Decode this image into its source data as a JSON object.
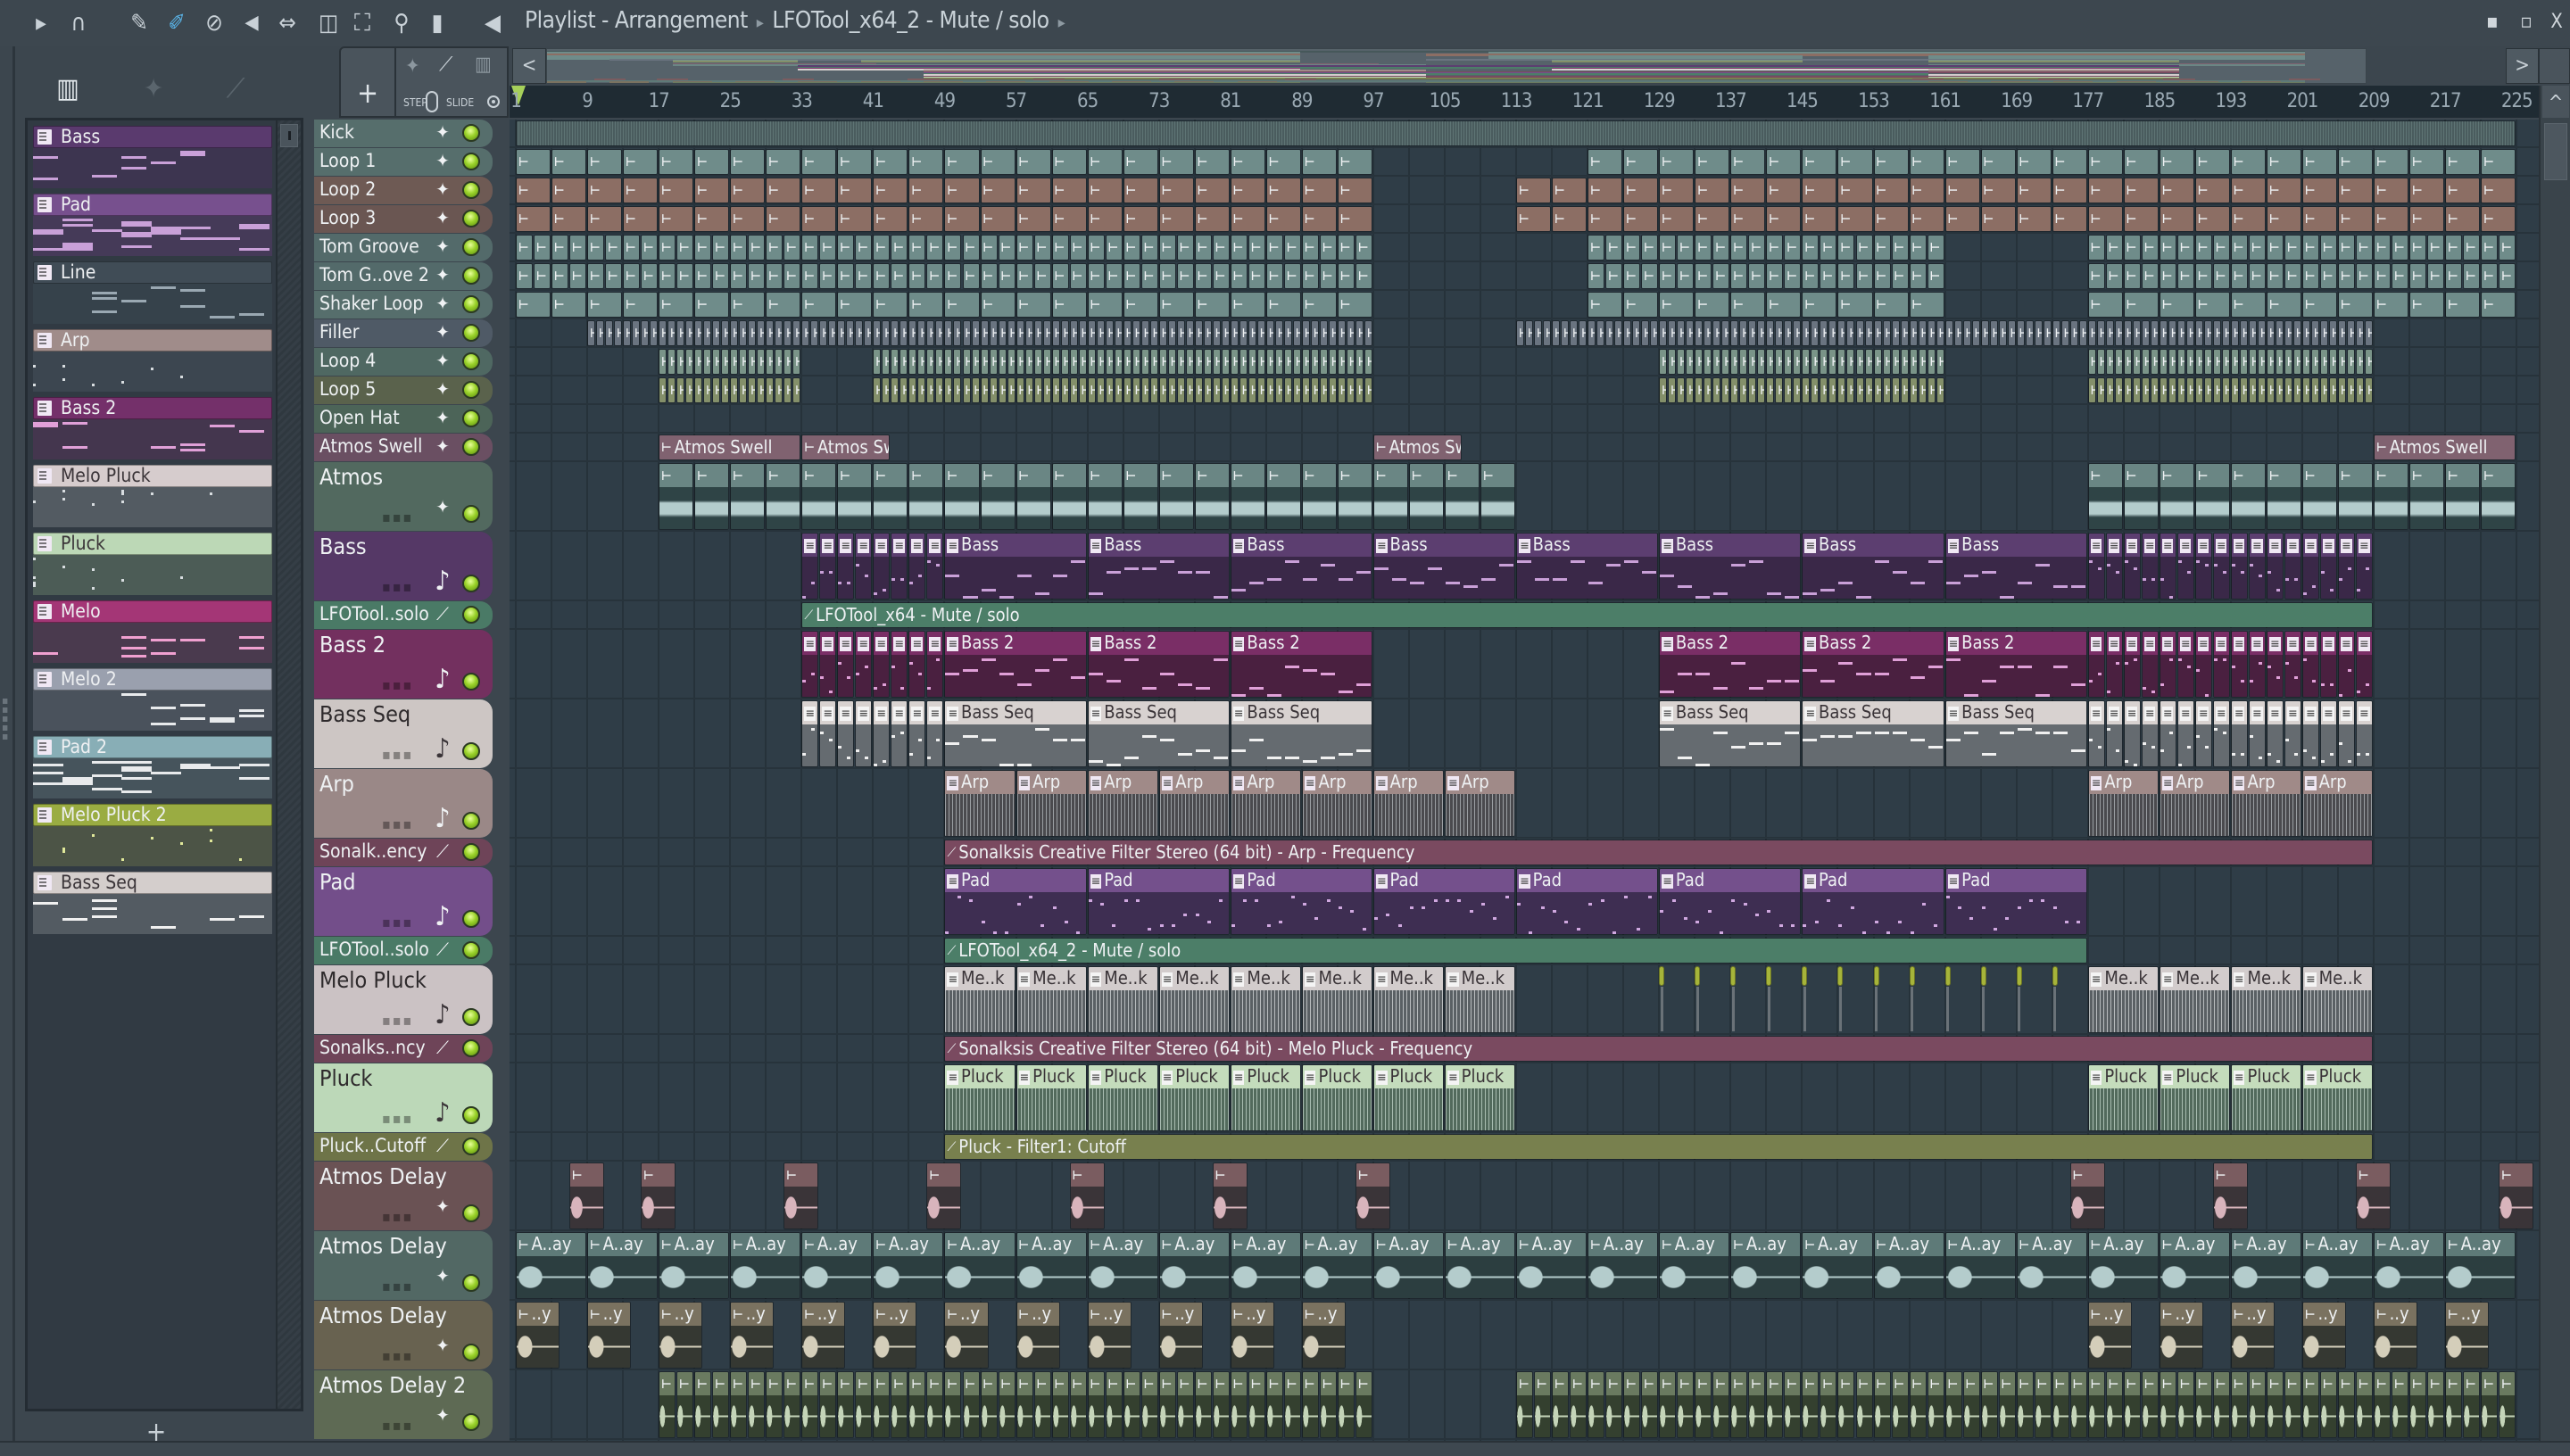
{
  "window": {
    "title": "Playlist - Arrangement",
    "breadcrumb": "LFOTool_x64_2 - Mute / solo",
    "controls": {
      "minimize": "▪",
      "maximize": "▫",
      "close": "X"
    }
  },
  "toolbar": {
    "icons": [
      "menu-arrow-icon",
      "magnet-snap-icon",
      "pencil-icon",
      "paint-brush-icon",
      "delete-icon",
      "mute-icon",
      "slip-icon",
      "select-icon",
      "zoom-select-icon",
      "zoom-icon",
      "playback-icon",
      "speaker-icon"
    ],
    "active_tool": "paint-brush-icon",
    "accent": "#5ab4e8"
  },
  "tools_panel": {
    "add_label": "+",
    "step_label": "STEP",
    "slide_label": "SLIDE"
  },
  "ruler": {
    "bars": [
      "1",
      "9",
      "17",
      "25",
      "33",
      "41",
      "49",
      "57",
      "65",
      "73",
      "81",
      "89",
      "97",
      "105",
      "113",
      "121",
      "129",
      "137",
      "145",
      "153",
      "161",
      "169",
      "177",
      "185",
      "193",
      "201",
      "209",
      "217",
      "225"
    ]
  },
  "scroll": {
    "up": "^",
    "left": "<",
    "right": ">"
  },
  "picker": {
    "add_label": "+",
    "channels": [
      {
        "name": "Bass",
        "color": "#5a3a6e",
        "note": "#c9a0d8",
        "bg": "#3d3550",
        "dark": false
      },
      {
        "name": "Pad",
        "color": "#77508e",
        "note": "#c9a0d8",
        "bg": "#453a58",
        "dark": false
      },
      {
        "name": "Line",
        "color": "#404c56",
        "note": "#9aa8b2",
        "bg": "#36424b",
        "dark": false
      },
      {
        "name": "Arp",
        "color": "#a08c8a",
        "note": "#d8dde0",
        "bg": "#3c4650",
        "dark": false
      },
      {
        "name": "Bass 2",
        "color": "#74306a",
        "note": "#e0a0d8",
        "bg": "#44364e",
        "dark": false
      },
      {
        "name": "Melo Pluck",
        "color": "#d6cccd",
        "note": "#d8dde0",
        "bg": "#535b62",
        "dark": true
      },
      {
        "name": "Pluck",
        "color": "#bcd8b6",
        "note": "#d8dde0",
        "bg": "#4c5c56",
        "dark": true
      },
      {
        "name": "Melo",
        "color": "#a43676",
        "note": "#f0a0d0",
        "bg": "#4a3a4e",
        "dark": false
      },
      {
        "name": "Melo 2",
        "color": "#9aa0ae",
        "note": "#e8eaec",
        "bg": "#4a525c",
        "dark": false
      },
      {
        "name": "Pad 2",
        "color": "#88aeb6",
        "note": "#e8eaec",
        "bg": "#46545c",
        "dark": false
      },
      {
        "name": "Melo Pluck 2",
        "color": "#9aac42",
        "note": "#e0e89a",
        "bg": "#4c5446",
        "dark": false
      },
      {
        "name": "Bass Seq",
        "color": "#d4cecc",
        "note": "#f0f0f0",
        "bg": "#535b62",
        "dark": true
      }
    ]
  },
  "tracks": [
    {
      "name": "Kick",
      "kind": "audio",
      "color": "#566e6c",
      "clip": "#46585a",
      "clips": [
        {
          "s": 1,
          "e": 225,
          "step": 224,
          "label": ""
        }
      ]
    },
    {
      "name": "Loop 1",
      "kind": "audio",
      "color": "#566e6c",
      "clip": "#6f8c8a",
      "clips": [
        {
          "s": 1,
          "e": 97,
          "step": 4,
          "label": ""
        },
        {
          "s": 121,
          "e": 225,
          "step": 4,
          "label": ""
        }
      ]
    },
    {
      "name": "Loop 2",
      "kind": "audio",
      "color": "#6e5a54",
      "clip": "#8c6e64",
      "clips": [
        {
          "s": 1,
          "e": 97,
          "step": 4,
          "label": ""
        },
        {
          "s": 113,
          "e": 225,
          "step": 4,
          "label": ""
        }
      ]
    },
    {
      "name": "Loop 3",
      "kind": "audio",
      "color": "#6a5652",
      "clip": "#8c6e64",
      "clips": [
        {
          "s": 1,
          "e": 97,
          "step": 4,
          "label": ""
        },
        {
          "s": 113,
          "e": 225,
          "step": 4,
          "label": ""
        }
      ]
    },
    {
      "name": "Tom Groove",
      "kind": "audio",
      "color": "#536a6a",
      "clip": "#6f8c8a",
      "clips": [
        {
          "s": 1,
          "e": 97,
          "step": 2,
          "label": ""
        },
        {
          "s": 121,
          "e": 161,
          "step": 2,
          "label": ""
        },
        {
          "s": 177,
          "e": 225,
          "step": 2,
          "label": ""
        }
      ]
    },
    {
      "name": "Tom G..ove 2",
      "kind": "audio",
      "color": "#536a6a",
      "clip": "#6f8c8a",
      "clips": [
        {
          "s": 1,
          "e": 97,
          "step": 2,
          "label": ""
        },
        {
          "s": 121,
          "e": 161,
          "step": 2,
          "label": ""
        },
        {
          "s": 177,
          "e": 225,
          "step": 2,
          "label": ""
        }
      ]
    },
    {
      "name": "Shaker Loop",
      "kind": "audio",
      "color": "#566e6c",
      "clip": "#6f8c8a",
      "clips": [
        {
          "s": 1,
          "e": 97,
          "step": 4,
          "label": ""
        },
        {
          "s": 121,
          "e": 161,
          "step": 4,
          "label": ""
        },
        {
          "s": 177,
          "e": 225,
          "step": 4,
          "label": ""
        }
      ]
    },
    {
      "name": "Filler",
      "kind": "audio",
      "color": "#4f5a66",
      "clip": "#6a7480",
      "clips": [
        {
          "s": 9,
          "e": 97,
          "step": 1,
          "label": ""
        },
        {
          "s": 113,
          "e": 209,
          "step": 1,
          "label": ""
        }
      ]
    },
    {
      "name": "Loop 4",
      "kind": "audio",
      "color": "#4f6862",
      "clip": "#7a9488",
      "clips": [
        {
          "s": 17,
          "e": 33,
          "step": 1,
          "label": ""
        },
        {
          "s": 41,
          "e": 97,
          "step": 1,
          "label": ""
        },
        {
          "s": 129,
          "e": 161,
          "step": 1,
          "label": ""
        },
        {
          "s": 177,
          "e": 209,
          "step": 1,
          "label": ""
        }
      ]
    },
    {
      "name": "Loop 5",
      "kind": "audio",
      "color": "#5a624c",
      "clip": "#84906a",
      "clips": [
        {
          "s": 17,
          "e": 33,
          "step": 1,
          "label": ""
        },
        {
          "s": 41,
          "e": 97,
          "step": 1,
          "label": ""
        },
        {
          "s": 129,
          "e": 161,
          "step": 1,
          "label": ""
        },
        {
          "s": 177,
          "e": 209,
          "step": 1,
          "label": ""
        }
      ]
    },
    {
      "name": "Open Hat",
      "kind": "audio",
      "color": "#4c6458",
      "clip": "#60786c",
      "clips": []
    },
    {
      "name": "Atmos Swell",
      "kind": "audio",
      "color": "#6a4f62",
      "clip": "#806270",
      "clips": [
        {
          "s": 17,
          "e": 33,
          "step": 16,
          "label": "Atmos Swell"
        },
        {
          "s": 33,
          "e": 43,
          "step": 10,
          "label": "Atmos Swell"
        },
        {
          "s": 97,
          "e": 107,
          "step": 10,
          "label": "Atmos Swell"
        },
        {
          "s": 209,
          "e": 225,
          "step": 16,
          "label": "Atmos Swell"
        }
      ]
    },
    {
      "name": "Atmos",
      "kind": "audio",
      "color": "#52695f",
      "clip": "#6a8684",
      "body": "#2f4446",
      "wave": "#b4cccc",
      "clips": [
        {
          "s": 17,
          "e": 113,
          "step": 4,
          "label": ""
        },
        {
          "s": 177,
          "e": 225,
          "step": 4,
          "label": ""
        }
      ]
    },
    {
      "name": "Bass",
      "kind": "pattern",
      "color": "#553866",
      "clip": "#5c3e70",
      "body": "#3a2848",
      "note": "#c9a0d8",
      "clips": [
        {
          "s": 33,
          "e": 49,
          "step": 2,
          "label": ""
        },
        {
          "s": 49,
          "e": 177,
          "step": 16,
          "label": "Bass"
        },
        {
          "s": 177,
          "e": 209,
          "step": 2,
          "label": ""
        }
      ]
    },
    {
      "name": "LFOTool..solo",
      "kind": "auto",
      "color": "#4a7a66",
      "clip": "#4c7e68",
      "clips": [
        {
          "s": 33,
          "e": 209,
          "step": 176,
          "label": "LFOTool_x64 - Mute / solo"
        }
      ]
    },
    {
      "name": "Bass 2",
      "kind": "pattern",
      "color": "#73305f",
      "clip": "#7a2e66",
      "body": "#4a2040",
      "note": "#e0a0d8",
      "clips": [
        {
          "s": 33,
          "e": 49,
          "step": 2,
          "label": ""
        },
        {
          "s": 49,
          "e": 97,
          "step": 16,
          "label": "Bass 2"
        },
        {
          "s": 129,
          "e": 177,
          "step": 16,
          "label": "Bass 2"
        },
        {
          "s": 177,
          "e": 209,
          "step": 2,
          "label": ""
        }
      ]
    },
    {
      "name": "Bass Seq",
      "kind": "pattern",
      "color": "#cdc6c4",
      "dark": true,
      "clip": "#d8d2d0",
      "body": "#656b70",
      "note": "#f0f0f0",
      "clips": [
        {
          "s": 33,
          "e": 49,
          "step": 2,
          "label": ""
        },
        {
          "s": 49,
          "e": 97,
          "step": 16,
          "label": "Bass Seq"
        },
        {
          "s": 129,
          "e": 177,
          "step": 16,
          "label": "Bass Seq"
        },
        {
          "s": 177,
          "e": 209,
          "step": 2,
          "label": ""
        }
      ]
    },
    {
      "name": "Arp",
      "kind": "pattern",
      "color": "#9a8887",
      "clip": "#a08a88",
      "body": "#4a4a4e",
      "note": "#9a9ea2",
      "clips": [
        {
          "s": 49,
          "e": 113,
          "step": 8,
          "label": "Arp"
        },
        {
          "s": 177,
          "e": 209,
          "step": 8,
          "label": "Arp"
        }
      ]
    },
    {
      "name": "Sonalk..ency",
      "kind": "auto",
      "color": "#6e4458",
      "clip": "#7a4a60",
      "clips": [
        {
          "s": 49,
          "e": 209,
          "step": 160,
          "label": "Sonalksis Creative Filter Stereo (64 bit) - Arp - Frequency"
        }
      ]
    },
    {
      "name": "Pad",
      "kind": "pattern",
      "color": "#734e8a",
      "clip": "#74508c",
      "body": "#3e2e52",
      "note": "#d0a8e0",
      "clips": [
        {
          "s": 49,
          "e": 177,
          "step": 16,
          "label": "Pad"
        }
      ]
    },
    {
      "name": "LFOTool..solo",
      "kind": "auto",
      "color": "#4a7a66",
      "clip": "#4c7e68",
      "clips": [
        {
          "s": 49,
          "e": 177,
          "step": 128,
          "label": "LFOTool_x64_2 - Mute / solo"
        }
      ]
    },
    {
      "name": "Melo Pluck",
      "kind": "pattern",
      "color": "#cbc2c4",
      "dark": true,
      "clip": "#d2cccc",
      "body": "#5a6064",
      "note": "#b8bcbe",
      "clips": [
        {
          "s": 49,
          "e": 113,
          "step": 8,
          "label": "Me..k"
        },
        {
          "s": 129,
          "e": 177,
          "step": 4,
          "len": 0.6,
          "label": "",
          "marker": "#a6b43a"
        },
        {
          "s": 177,
          "e": 209,
          "step": 8,
          "label": "Me..k"
        }
      ]
    },
    {
      "name": "Sonalks..ncy",
      "kind": "auto",
      "color": "#6e4458",
      "clip": "#7a4a60",
      "clips": [
        {
          "s": 49,
          "e": 209,
          "step": 160,
          "label": "Sonalksis Creative Filter Stereo (64 bit) - Melo Pluck - Frequency"
        }
      ]
    },
    {
      "name": "Pluck",
      "kind": "pattern",
      "color": "#bcd8b8",
      "dark": true,
      "clip": "#c4dcbc",
      "body": "#526a5c",
      "note": "#a8bcb0",
      "clips": [
        {
          "s": 49,
          "e": 113,
          "step": 8,
          "label": "Pluck"
        },
        {
          "s": 177,
          "e": 209,
          "step": 8,
          "label": "Pluck"
        }
      ]
    },
    {
      "name": "Pluck..Cutoff",
      "kind": "auto",
      "color": "#6e7448",
      "clip": "#78804e",
      "clips": [
        {
          "s": 49,
          "e": 209,
          "step": 160,
          "label": "Pluck - Filter1: Cutoff"
        }
      ]
    },
    {
      "name": "Atmos Delay",
      "kind": "audio",
      "color": "#6a5254",
      "clip": "#7a5c60",
      "body": "#3a3438",
      "wave": "#d8b4bc",
      "clips": [
        {
          "s": 7,
          "e": 11,
          "step": 4,
          "label": ""
        },
        {
          "s": 15,
          "e": 19,
          "step": 4,
          "label": ""
        },
        {
          "s": 31,
          "e": 111,
          "step": 16,
          "len": 4,
          "label": ""
        },
        {
          "s": 175,
          "e": 227,
          "step": 16,
          "len": 4,
          "label": ""
        }
      ]
    },
    {
      "name": "Atmos Delay",
      "kind": "audio",
      "color": "#526864",
      "clip": "#5e7a78",
      "body": "#2c3e40",
      "wave": "#b4cccc",
      "clips": [
        {
          "s": 1,
          "e": 225,
          "step": 8,
          "label": "A..ay"
        }
      ]
    },
    {
      "name": "Atmos Delay",
      "kind": "audio",
      "color": "#686250",
      "clip": "#7a7260",
      "body": "#353832",
      "wave": "#d4ceba",
      "clips": [
        {
          "s": 1,
          "e": 97,
          "step": 8,
          "len": 5,
          "label": "..y"
        },
        {
          "s": 177,
          "e": 225,
          "step": 8,
          "len": 5,
          "label": "..y"
        }
      ]
    },
    {
      "name": "Atmos Delay 2",
      "kind": "audio",
      "color": "#5e6a54",
      "clip": "#6a7a60",
      "body": "#34402f",
      "wave": "#c4d4b8",
      "clips": [
        {
          "s": 17,
          "e": 97,
          "step": 2,
          "label": ""
        },
        {
          "s": 113,
          "e": 225,
          "step": 2,
          "label": ""
        }
      ]
    }
  ]
}
